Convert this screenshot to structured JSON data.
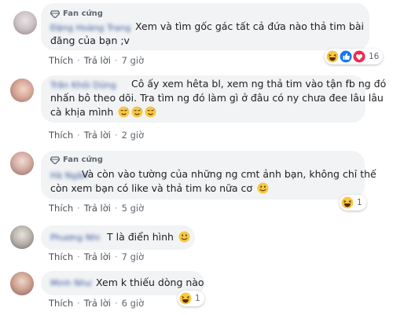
{
  "badge_label": "Fan cứng",
  "actions": {
    "like": "Thích",
    "reply": "Trả lời",
    "sep": "·"
  },
  "comments": [
    {
      "name": "Đặng Hoàng Trang",
      "line1": "Xem và tìm gốc gác tất cả đứa nào thả tim bài",
      "line2": "đăng của bạn ;v",
      "time": "7 giờ",
      "reaction_count": "16",
      "reactions": [
        "haha-icon",
        "like-icon",
        "love-icon"
      ]
    },
    {
      "name": "Trần Khôi Dũng",
      "line1": "Cô ấy xem hêta bl, xem ng thả tim vào tận fb ng đó",
      "line2": "nhấn bô theo dõi. Tra tìm ng đó làm gì ở đâu có ny chưa đee lâu lâu",
      "line3": "cà khịa mình",
      "time": "2 giờ",
      "emojis": [
        "sweat-smile-icon",
        "sweat-smile-icon",
        "sweat-smile-icon"
      ]
    },
    {
      "name": "Hà Ngân",
      "line1": "Và còn vào tường của những ng cmt ảnh bạn, không chỉ thế",
      "line2": "còn xem bạn có like và thả tim ko nữa cơ",
      "time": "5 giờ",
      "reaction_count": "1",
      "emojis": [
        "smile-icon"
      ]
    },
    {
      "name": "Phương Nhi",
      "line1": "T là điển hình",
      "time": "7 giờ",
      "emojis": [
        "smile-icon"
      ]
    },
    {
      "name": "Minh Như",
      "line1": "Xem k thiếu dòng nào",
      "time": "6 giờ",
      "reaction_count": "1"
    }
  ]
}
